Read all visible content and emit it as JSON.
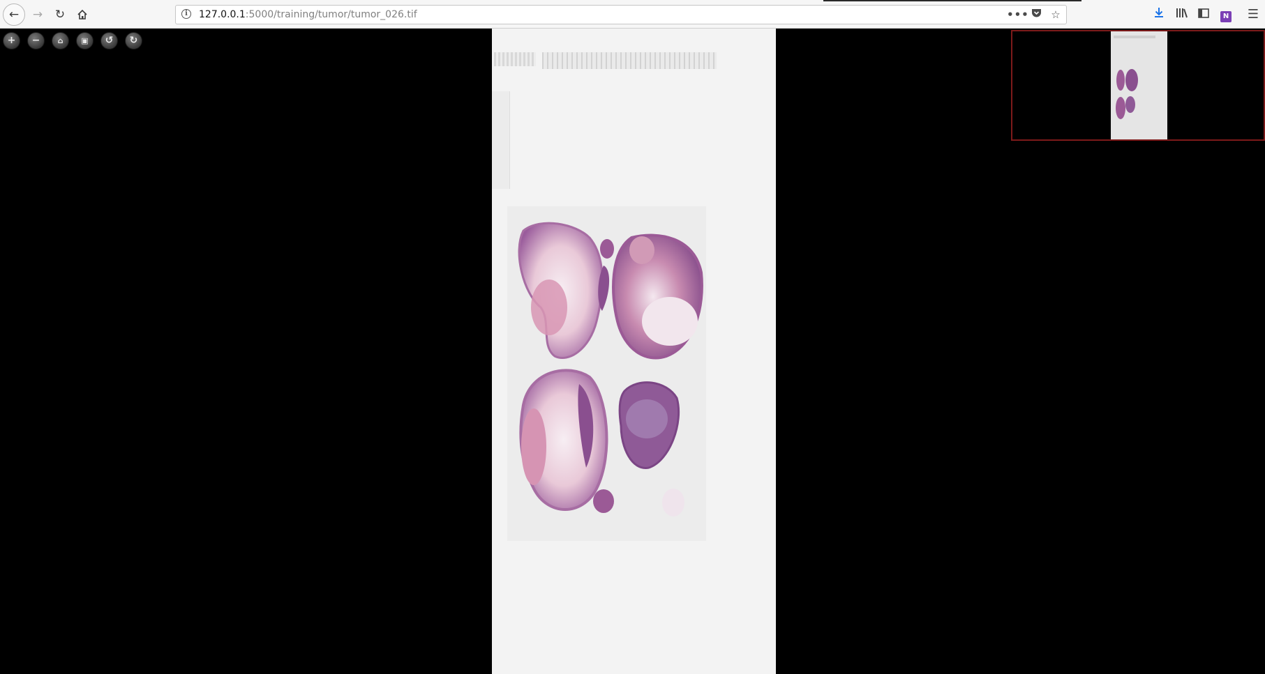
{
  "browser": {
    "url_host": "127.0.0.1",
    "url_rest": ":5000/training/tumor/tumor_026.tif",
    "icons": {
      "back": "back-arrow-icon",
      "forward": "forward-arrow-icon",
      "reload": "reload-icon",
      "home": "home-icon",
      "info": "info-icon",
      "more": "page-actions-icon",
      "pocket": "pocket-icon",
      "star": "bookmark-star-icon",
      "download": "download-icon",
      "library": "library-icon",
      "sidebar": "sidebar-icon",
      "onenote": "onenote-icon",
      "menu": "hamburger-menu-icon"
    },
    "onenote_glyph": "N"
  },
  "viewer": {
    "controls": [
      "zoom-in",
      "zoom-out",
      "home",
      "full-page",
      "rotate-left",
      "rotate-right"
    ],
    "colors": {
      "background": "#000000",
      "slide": "#f3f3f3",
      "tissue_dark": "#8a4f8f",
      "tissue_light": "#d49ab3",
      "minimap_border": "#7d1a1a"
    }
  }
}
